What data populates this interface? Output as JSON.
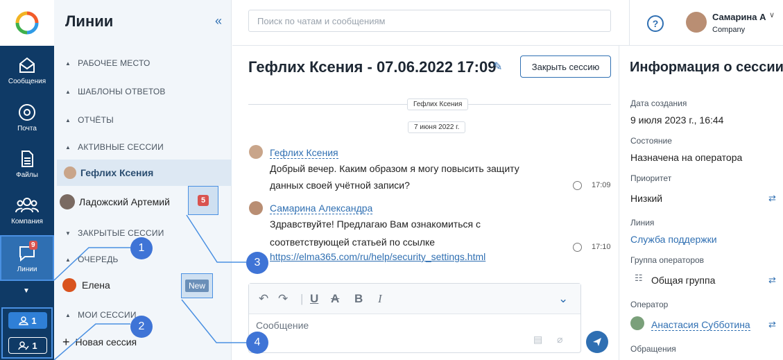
{
  "rail": {
    "items": [
      {
        "label": "Сообщения",
        "icon": "mail-icon"
      },
      {
        "label": "Почта",
        "icon": "at-icon"
      },
      {
        "label": "Файлы",
        "icon": "file-icon"
      },
      {
        "label": "Компания",
        "icon": "people-icon"
      },
      {
        "label": "Линии",
        "icon": "chat-icon",
        "badge": "9"
      }
    ],
    "counters": [
      {
        "value": "1"
      },
      {
        "value": "1"
      }
    ]
  },
  "lines": {
    "title": "Линии",
    "sections": {
      "workspace": "РАБОЧЕЕ МЕСТО",
      "templates": "ШАБЛОНЫ ОТВЕТОВ",
      "reports": "ОТЧЁТЫ",
      "active": "АКТИВНЫЕ СЕССИИ",
      "closed": "ЗАКРЫТЫЕ СЕССИИ",
      "queue": "ОЧЕРЕДЬ",
      "mine": "МОИ СЕССИИ"
    },
    "active_sessions": [
      {
        "name": "Гефлих Ксения"
      },
      {
        "name": "Ладожский Артемий",
        "badge": "5"
      }
    ],
    "queue_item": {
      "name": "Елена",
      "badge": "New"
    },
    "new_session": "Новая сессия"
  },
  "header": {
    "search_placeholder": "Поиск по чатам и сообщениям",
    "help": "?",
    "user_name": "Самарина А",
    "user_company": "Company"
  },
  "chat": {
    "title": "Гефлих Ксения - 07.06.2022 17:09",
    "close_button": "Закрыть сессию",
    "chip_name": "Гефлих Ксения",
    "chip_date": "7 июня 2022 г.",
    "messages": [
      {
        "author": "Гефлих Ксения",
        "line1": "Добрый вечер. Каким образом я могу повысить защиту",
        "line2": "данных своей учётной записи?",
        "time": "17:09"
      },
      {
        "author": "Самарина Александра",
        "line1": "Здравствуйте! Предлагаю Вам ознакомиться с",
        "line2": "соответствующей статьей по ссылке",
        "link": "https://elma365.com/ru/help/security_settings.html",
        "time": "17:10"
      }
    ],
    "editor_placeholder": "Сообщение"
  },
  "info": {
    "title": "Информация о сессии",
    "created_label": "Дата создания",
    "created_value": "9 июля 2023 г., 16:44",
    "state_label": "Состояние",
    "state_value": "Назначена на оператора",
    "priority_label": "Приоритет",
    "priority_value": "Низкий",
    "line_label": "Линия",
    "line_value": "Служба поддержки",
    "group_label": "Группа операторов",
    "group_value": "Общая группа",
    "operator_label": "Оператор",
    "operator_value": "Анастасия Субботина",
    "requests_label": "Обращения"
  },
  "annotations": [
    "1",
    "2",
    "3",
    "4"
  ]
}
